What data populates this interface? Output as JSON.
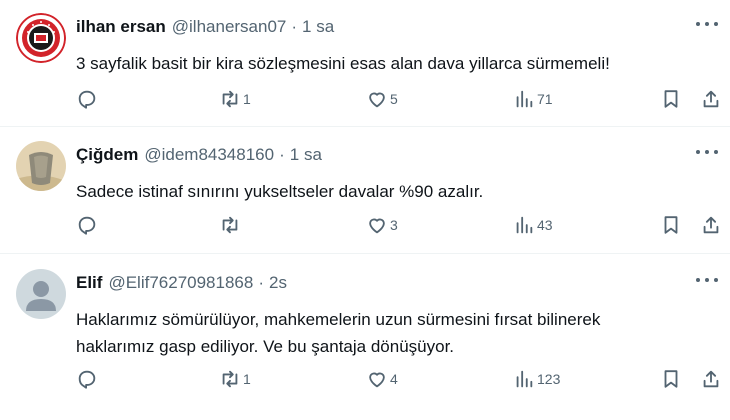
{
  "tweets": [
    {
      "name": "ilhan ersan",
      "handle": "@ilhanersan07",
      "separator": "·",
      "time": "1 sa",
      "avatar_kind": "logo",
      "lines": [
        "3 sayfalik basit bir kira sözleşmesini esas alan dava yillarca sürmemeli!"
      ],
      "retweets": "1",
      "likes": "5",
      "views": "71"
    },
    {
      "name": "Çiğdem",
      "handle": "@idem84348160",
      "separator": "·",
      "time": "1 sa",
      "avatar_kind": "photo",
      "lines": [
        "Sadece istinaf sınırını yukseltseler davalar %90 azalır."
      ],
      "retweets": "",
      "likes": "3",
      "views": "43"
    },
    {
      "name": "Elif",
      "handle": "@Elif76270981868",
      "separator": "·",
      "time": "2s",
      "avatar_kind": "default",
      "lines": [
        "Haklarımız sömürülüyor, mahkemelerin uzun sürmesini fırsat bilinerek",
        "haklarımız gasp ediliyor. Ve bu şantaja dönüşüyor."
      ],
      "retweets": "1",
      "likes": "4",
      "views": "123"
    }
  ],
  "icons": {
    "reply": "reply-icon",
    "retweet": "retweet-icon",
    "like": "heart-icon",
    "views": "views-icon",
    "bookmark": "bookmark-icon",
    "share": "share-icon",
    "more": "more-icon"
  },
  "colors": {
    "text": "#0f1419",
    "secondary": "#536471",
    "divider": "#eff3f4",
    "logo_red": "#d2232a"
  }
}
